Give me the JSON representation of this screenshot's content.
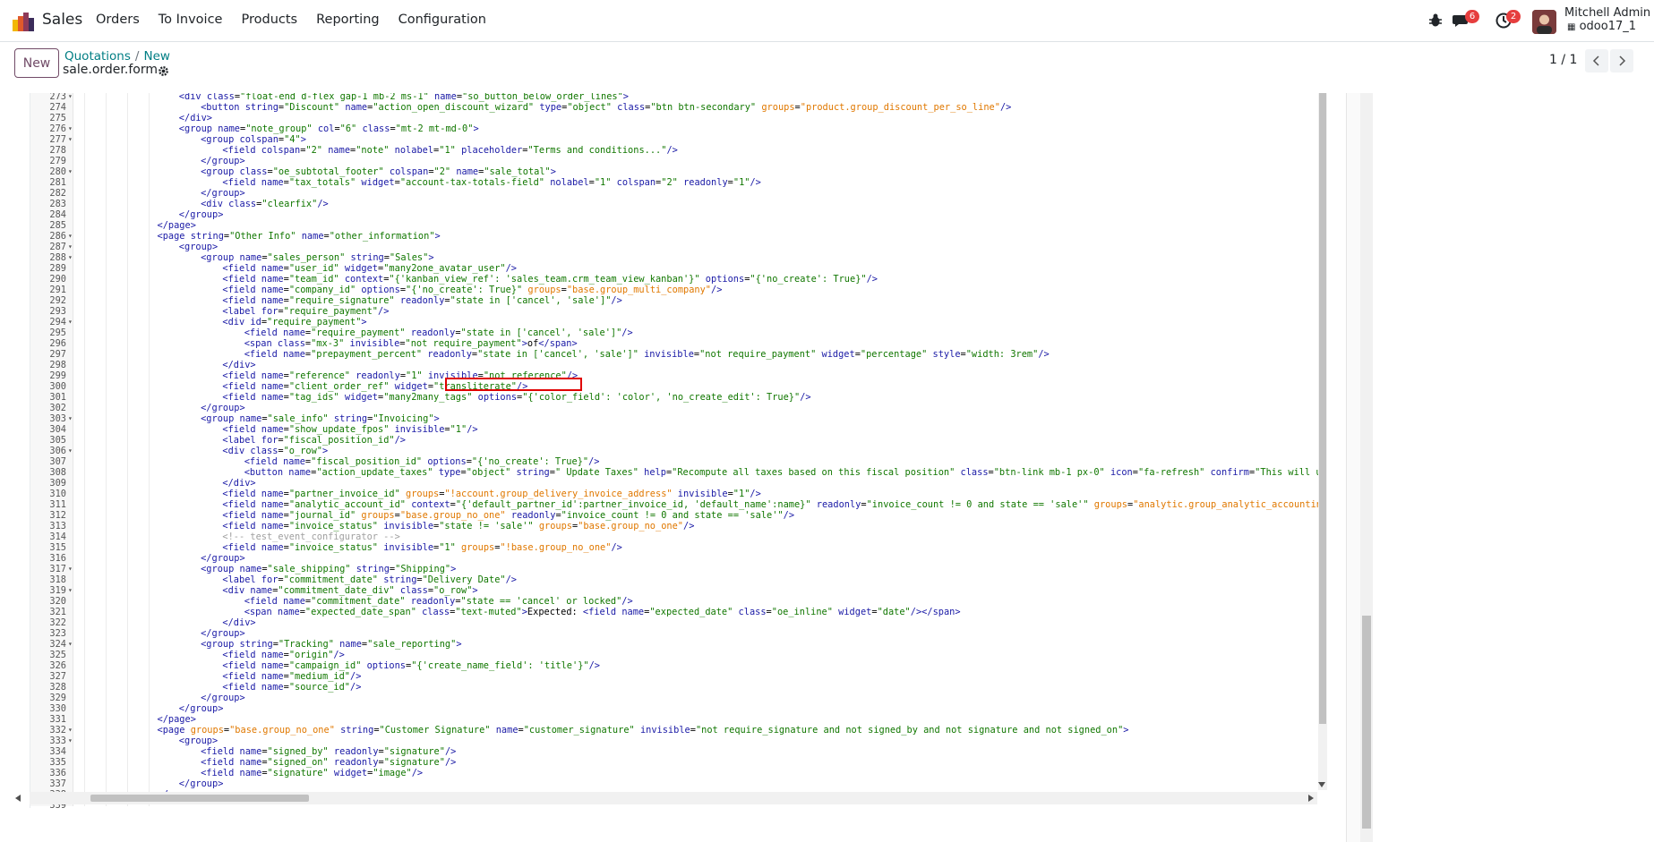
{
  "navbar": {
    "app_name": "Sales",
    "menu": [
      "Orders",
      "To Invoice",
      "Products",
      "Reporting",
      "Configuration"
    ],
    "messages_badge": "6",
    "activities_badge": "2",
    "user_name": "Mitchell Admin",
    "db_name": "odoo17_1"
  },
  "control": {
    "new_label": "New",
    "breadcrumb_parent": "Quotations",
    "breadcrumb_current": "New",
    "record_name": "sale.order.form",
    "pager": "1 / 1"
  },
  "colors": {
    "brand": "#714B67",
    "link": "#017e84",
    "highlight": "#e00000"
  },
  "code_lines": [
    {
      "n": "273",
      "fold": true,
      "indent": 6,
      "text": "<div class=\"float-end d-flex gap-1 mb-2 ms-1\" name=\"so_button_below_order_lines\">"
    },
    {
      "n": "274",
      "fold": false,
      "indent": 7,
      "text": "<button string=\"Discount\" name=\"action_open_discount_wizard\" type=\"object\" class=\"btn btn-secondary\" groups=\"product.group_discount_per_so_line\"/>"
    },
    {
      "n": "275",
      "fold": false,
      "indent": 6,
      "text": "</div>"
    },
    {
      "n": "276",
      "fold": true,
      "indent": 6,
      "text": "<group name=\"note_group\" col=\"6\" class=\"mt-2 mt-md-0\">"
    },
    {
      "n": "277",
      "fold": true,
      "indent": 7,
      "text": "<group colspan=\"4\">"
    },
    {
      "n": "278",
      "fold": false,
      "indent": 8,
      "text": "<field colspan=\"2\" name=\"note\" nolabel=\"1\" placeholder=\"Terms and conditions...\"/>"
    },
    {
      "n": "279",
      "fold": false,
      "indent": 7,
      "text": "</group>"
    },
    {
      "n": "280",
      "fold": true,
      "indent": 7,
      "text": "<group class=\"oe_subtotal_footer\" colspan=\"2\" name=\"sale_total\">"
    },
    {
      "n": "281",
      "fold": false,
      "indent": 8,
      "text": "<field name=\"tax_totals\" widget=\"account-tax-totals-field\" nolabel=\"1\" colspan=\"2\" readonly=\"1\"/>"
    },
    {
      "n": "282",
      "fold": false,
      "indent": 7,
      "text": "</group>"
    },
    {
      "n": "283",
      "fold": false,
      "indent": 7,
      "text": "<div class=\"clearfix\"/>"
    },
    {
      "n": "284",
      "fold": false,
      "indent": 6,
      "text": "</group>"
    },
    {
      "n": "285",
      "fold": false,
      "indent": 5,
      "text": "</page>"
    },
    {
      "n": "286",
      "fold": true,
      "indent": 5,
      "text": "<page string=\"Other Info\" name=\"other_information\">"
    },
    {
      "n": "287",
      "fold": true,
      "indent": 6,
      "text": "<group>"
    },
    {
      "n": "288",
      "fold": true,
      "indent": 7,
      "text": "<group name=\"sales_person\" string=\"Sales\">"
    },
    {
      "n": "289",
      "fold": false,
      "indent": 8,
      "text": "<field name=\"user_id\" widget=\"many2one_avatar_user\"/>"
    },
    {
      "n": "290",
      "fold": false,
      "indent": 8,
      "text": "<field name=\"team_id\" context=\"{'kanban_view_ref': 'sales_team.crm_team_view_kanban'}\" options=\"{'no_create': True}\"/>"
    },
    {
      "n": "291",
      "fold": false,
      "indent": 8,
      "text": "<field name=\"company_id\" options=\"{'no_create': True}\" groups=\"base.group_multi_company\"/>"
    },
    {
      "n": "292",
      "fold": false,
      "indent": 8,
      "text": "<field name=\"require_signature\" readonly=\"state in ['cancel', 'sale']\"/>"
    },
    {
      "n": "293",
      "fold": false,
      "indent": 8,
      "text": "<label for=\"require_payment\"/>"
    },
    {
      "n": "294",
      "fold": true,
      "indent": 8,
      "text": "<div id=\"require_payment\">"
    },
    {
      "n": "295",
      "fold": false,
      "indent": 9,
      "text": "<field name=\"require_payment\" readonly=\"state in ['cancel', 'sale']\"/>"
    },
    {
      "n": "296",
      "fold": false,
      "indent": 9,
      "text": "<span class=\"mx-3\" invisible=\"not require_payment\">of</span>"
    },
    {
      "n": "297",
      "fold": false,
      "indent": 9,
      "text": "<field name=\"prepayment_percent\" readonly=\"state in ['cancel', 'sale']\" invisible=\"not require_payment\" widget=\"percentage\" style=\"width: 3rem\"/>"
    },
    {
      "n": "298",
      "fold": false,
      "indent": 8,
      "text": "</div>"
    },
    {
      "n": "299",
      "fold": false,
      "indent": 8,
      "text": "<field name=\"reference\" readonly=\"1\" invisible=\"not reference\"/>"
    },
    {
      "n": "300",
      "fold": false,
      "indent": 8,
      "text": "<field name=\"client_order_ref\" widget=\"transliterate\"/>"
    },
    {
      "n": "301",
      "fold": false,
      "indent": 8,
      "text": "<field name=\"tag_ids\" widget=\"many2many_tags\" options=\"{'color_field': 'color', 'no_create_edit': True}\"/>"
    },
    {
      "n": "302",
      "fold": false,
      "indent": 7,
      "text": "</group>"
    },
    {
      "n": "303",
      "fold": true,
      "indent": 7,
      "text": "<group name=\"sale_info\" string=\"Invoicing\">"
    },
    {
      "n": "304",
      "fold": false,
      "indent": 8,
      "text": "<field name=\"show_update_fpos\" invisible=\"1\"/>"
    },
    {
      "n": "305",
      "fold": false,
      "indent": 8,
      "text": "<label for=\"fiscal_position_id\"/>"
    },
    {
      "n": "306",
      "fold": true,
      "indent": 8,
      "text": "<div class=\"o_row\">"
    },
    {
      "n": "307",
      "fold": false,
      "indent": 9,
      "text": "<field name=\"fiscal_position_id\" options=\"{'no_create': True}\"/>"
    },
    {
      "n": "308",
      "fold": false,
      "indent": 9,
      "text": "<button name=\"action_update_taxes\" type=\"object\" string=\" Update Taxes\" help=\"Recompute all taxes based on this fiscal position\" class=\"btn-link mb-1 px-0\" icon=\"fa-refresh\" confirm=\"This will u"
    },
    {
      "n": "309",
      "fold": false,
      "indent": 8,
      "text": "</div>"
    },
    {
      "n": "310",
      "fold": false,
      "indent": 8,
      "text": "<field name=\"partner_invoice_id\" groups=\"!account.group_delivery_invoice_address\" invisible=\"1\"/>"
    },
    {
      "n": "311",
      "fold": false,
      "indent": 8,
      "text": "<field name=\"analytic_account_id\" context=\"{'default_partner_id':partner_invoice_id, 'default_name':name}\" readonly=\"invoice_count != 0 and state == 'sale'\" groups=\"analytic.group_analytic_accountin"
    },
    {
      "n": "312",
      "fold": false,
      "indent": 8,
      "text": "<field name=\"journal_id\" groups=\"base.group_no_one\" readonly=\"invoice_count != 0 and state == 'sale'\"/>"
    },
    {
      "n": "313",
      "fold": false,
      "indent": 8,
      "text": "<field name=\"invoice_status\" invisible=\"state != 'sale'\" groups=\"base.group_no_one\"/>"
    },
    {
      "n": "314",
      "fold": false,
      "indent": 8,
      "text": "<!-- test_event_configurator -->"
    },
    {
      "n": "315",
      "fold": false,
      "indent": 8,
      "text": "<field name=\"invoice_status\" invisible=\"1\" groups=\"!base.group_no_one\"/>"
    },
    {
      "n": "316",
      "fold": false,
      "indent": 7,
      "text": "</group>"
    },
    {
      "n": "317",
      "fold": true,
      "indent": 7,
      "text": "<group name=\"sale_shipping\" string=\"Shipping\">"
    },
    {
      "n": "318",
      "fold": false,
      "indent": 8,
      "text": "<label for=\"commitment_date\" string=\"Delivery Date\"/>"
    },
    {
      "n": "319",
      "fold": true,
      "indent": 8,
      "text": "<div name=\"commitment_date_div\" class=\"o_row\">"
    },
    {
      "n": "320",
      "fold": false,
      "indent": 9,
      "text": "<field name=\"commitment_date\" readonly=\"state == 'cancel' or locked\"/>"
    },
    {
      "n": "321",
      "fold": false,
      "indent": 9,
      "text": "<span name=\"expected_date_span\" class=\"text-muted\">Expected: <field name=\"expected_date\" class=\"oe_inline\" widget=\"date\"/></span>"
    },
    {
      "n": "322",
      "fold": false,
      "indent": 8,
      "text": "</div>"
    },
    {
      "n": "323",
      "fold": false,
      "indent": 7,
      "text": "</group>"
    },
    {
      "n": "324",
      "fold": true,
      "indent": 7,
      "text": "<group string=\"Tracking\" name=\"sale_reporting\">"
    },
    {
      "n": "325",
      "fold": false,
      "indent": 8,
      "text": "<field name=\"origin\"/>"
    },
    {
      "n": "326",
      "fold": false,
      "indent": 8,
      "text": "<field name=\"campaign_id\" options=\"{'create_name_field': 'title'}\"/>"
    },
    {
      "n": "327",
      "fold": false,
      "indent": 8,
      "text": "<field name=\"medium_id\"/>"
    },
    {
      "n": "328",
      "fold": false,
      "indent": 8,
      "text": "<field name=\"source_id\"/>"
    },
    {
      "n": "329",
      "fold": false,
      "indent": 7,
      "text": "</group>"
    },
    {
      "n": "330",
      "fold": false,
      "indent": 6,
      "text": "</group>"
    },
    {
      "n": "331",
      "fold": false,
      "indent": 5,
      "text": "</page>"
    },
    {
      "n": "332",
      "fold": true,
      "indent": 5,
      "text": "<page groups=\"base.group_no_one\" string=\"Customer Signature\" name=\"customer_signature\" invisible=\"not require_signature and not signed_by and not signature and not signed_on\">"
    },
    {
      "n": "333",
      "fold": true,
      "indent": 6,
      "text": "<group>"
    },
    {
      "n": "334",
      "fold": false,
      "indent": 7,
      "text": "<field name=\"signed_by\" readonly=\"signature\"/>"
    },
    {
      "n": "335",
      "fold": false,
      "indent": 7,
      "text": "<field name=\"signed_on\" readonly=\"signature\"/>"
    },
    {
      "n": "336",
      "fold": false,
      "indent": 7,
      "text": "<field name=\"signature\" widget=\"image\"/>"
    },
    {
      "n": "337",
      "fold": false,
      "indent": 6,
      "text": "</group>"
    },
    {
      "n": "338",
      "fold": false,
      "indent": 5,
      "text": "</page>"
    },
    {
      "n": "339",
      "fold": false,
      "indent": 5,
      "text": ""
    }
  ]
}
